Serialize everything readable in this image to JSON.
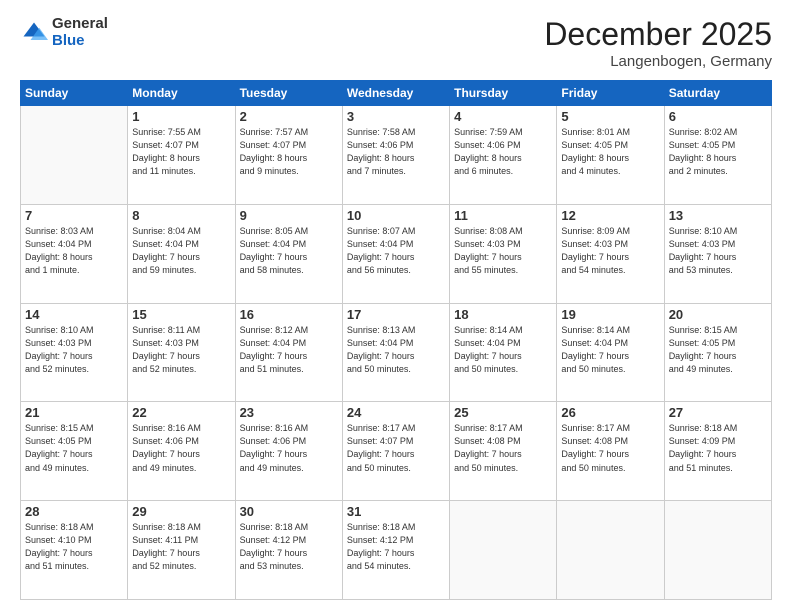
{
  "logo": {
    "general": "General",
    "blue": "Blue"
  },
  "header": {
    "month": "December 2025",
    "location": "Langenbogen, Germany"
  },
  "days_of_week": [
    "Sunday",
    "Monday",
    "Tuesday",
    "Wednesday",
    "Thursday",
    "Friday",
    "Saturday"
  ],
  "weeks": [
    [
      {
        "day": "",
        "info": ""
      },
      {
        "day": "1",
        "info": "Sunrise: 7:55 AM\nSunset: 4:07 PM\nDaylight: 8 hours\nand 11 minutes."
      },
      {
        "day": "2",
        "info": "Sunrise: 7:57 AM\nSunset: 4:07 PM\nDaylight: 8 hours\nand 9 minutes."
      },
      {
        "day": "3",
        "info": "Sunrise: 7:58 AM\nSunset: 4:06 PM\nDaylight: 8 hours\nand 7 minutes."
      },
      {
        "day": "4",
        "info": "Sunrise: 7:59 AM\nSunset: 4:06 PM\nDaylight: 8 hours\nand 6 minutes."
      },
      {
        "day": "5",
        "info": "Sunrise: 8:01 AM\nSunset: 4:05 PM\nDaylight: 8 hours\nand 4 minutes."
      },
      {
        "day": "6",
        "info": "Sunrise: 8:02 AM\nSunset: 4:05 PM\nDaylight: 8 hours\nand 2 minutes."
      }
    ],
    [
      {
        "day": "7",
        "info": "Sunrise: 8:03 AM\nSunset: 4:04 PM\nDaylight: 8 hours\nand 1 minute."
      },
      {
        "day": "8",
        "info": "Sunrise: 8:04 AM\nSunset: 4:04 PM\nDaylight: 7 hours\nand 59 minutes."
      },
      {
        "day": "9",
        "info": "Sunrise: 8:05 AM\nSunset: 4:04 PM\nDaylight: 7 hours\nand 58 minutes."
      },
      {
        "day": "10",
        "info": "Sunrise: 8:07 AM\nSunset: 4:04 PM\nDaylight: 7 hours\nand 56 minutes."
      },
      {
        "day": "11",
        "info": "Sunrise: 8:08 AM\nSunset: 4:03 PM\nDaylight: 7 hours\nand 55 minutes."
      },
      {
        "day": "12",
        "info": "Sunrise: 8:09 AM\nSunset: 4:03 PM\nDaylight: 7 hours\nand 54 minutes."
      },
      {
        "day": "13",
        "info": "Sunrise: 8:10 AM\nSunset: 4:03 PM\nDaylight: 7 hours\nand 53 minutes."
      }
    ],
    [
      {
        "day": "14",
        "info": "Sunrise: 8:10 AM\nSunset: 4:03 PM\nDaylight: 7 hours\nand 52 minutes."
      },
      {
        "day": "15",
        "info": "Sunrise: 8:11 AM\nSunset: 4:03 PM\nDaylight: 7 hours\nand 52 minutes."
      },
      {
        "day": "16",
        "info": "Sunrise: 8:12 AM\nSunset: 4:04 PM\nDaylight: 7 hours\nand 51 minutes."
      },
      {
        "day": "17",
        "info": "Sunrise: 8:13 AM\nSunset: 4:04 PM\nDaylight: 7 hours\nand 50 minutes."
      },
      {
        "day": "18",
        "info": "Sunrise: 8:14 AM\nSunset: 4:04 PM\nDaylight: 7 hours\nand 50 minutes."
      },
      {
        "day": "19",
        "info": "Sunrise: 8:14 AM\nSunset: 4:04 PM\nDaylight: 7 hours\nand 50 minutes."
      },
      {
        "day": "20",
        "info": "Sunrise: 8:15 AM\nSunset: 4:05 PM\nDaylight: 7 hours\nand 49 minutes."
      }
    ],
    [
      {
        "day": "21",
        "info": "Sunrise: 8:15 AM\nSunset: 4:05 PM\nDaylight: 7 hours\nand 49 minutes."
      },
      {
        "day": "22",
        "info": "Sunrise: 8:16 AM\nSunset: 4:06 PM\nDaylight: 7 hours\nand 49 minutes."
      },
      {
        "day": "23",
        "info": "Sunrise: 8:16 AM\nSunset: 4:06 PM\nDaylight: 7 hours\nand 49 minutes."
      },
      {
        "day": "24",
        "info": "Sunrise: 8:17 AM\nSunset: 4:07 PM\nDaylight: 7 hours\nand 50 minutes."
      },
      {
        "day": "25",
        "info": "Sunrise: 8:17 AM\nSunset: 4:08 PM\nDaylight: 7 hours\nand 50 minutes."
      },
      {
        "day": "26",
        "info": "Sunrise: 8:17 AM\nSunset: 4:08 PM\nDaylight: 7 hours\nand 50 minutes."
      },
      {
        "day": "27",
        "info": "Sunrise: 8:18 AM\nSunset: 4:09 PM\nDaylight: 7 hours\nand 51 minutes."
      }
    ],
    [
      {
        "day": "28",
        "info": "Sunrise: 8:18 AM\nSunset: 4:10 PM\nDaylight: 7 hours\nand 51 minutes."
      },
      {
        "day": "29",
        "info": "Sunrise: 8:18 AM\nSunset: 4:11 PM\nDaylight: 7 hours\nand 52 minutes."
      },
      {
        "day": "30",
        "info": "Sunrise: 8:18 AM\nSunset: 4:12 PM\nDaylight: 7 hours\nand 53 minutes."
      },
      {
        "day": "31",
        "info": "Sunrise: 8:18 AM\nSunset: 4:12 PM\nDaylight: 7 hours\nand 54 minutes."
      },
      {
        "day": "",
        "info": ""
      },
      {
        "day": "",
        "info": ""
      },
      {
        "day": "",
        "info": ""
      }
    ]
  ]
}
